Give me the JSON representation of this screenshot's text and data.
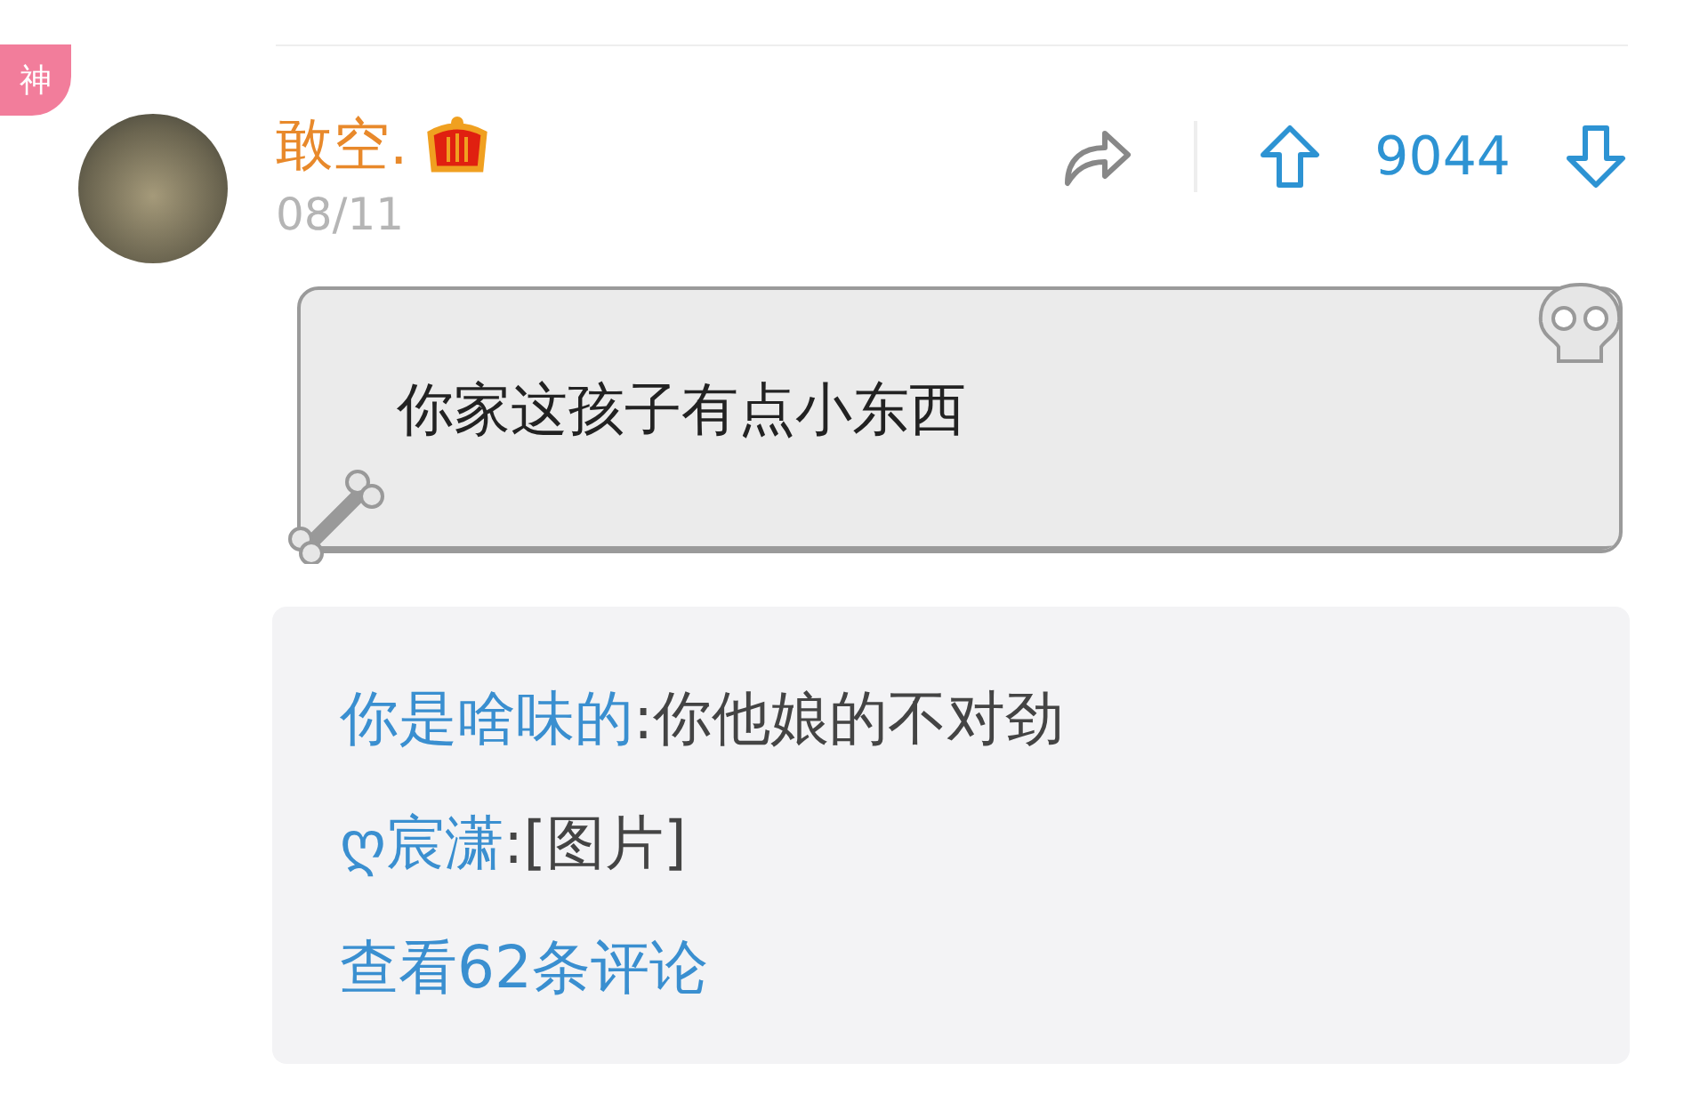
{
  "badge": "神",
  "post": {
    "author": "敢空.",
    "date": "08/11",
    "votes": "9044",
    "text": "你家这孩子有点小东西"
  },
  "replies": [
    {
      "author": "你是啥味的",
      "text": ":你他娘的不对劲"
    },
    {
      "author": "ღ宸潇",
      "text": ":[图片]"
    }
  ],
  "more_link": "查看62条评论"
}
